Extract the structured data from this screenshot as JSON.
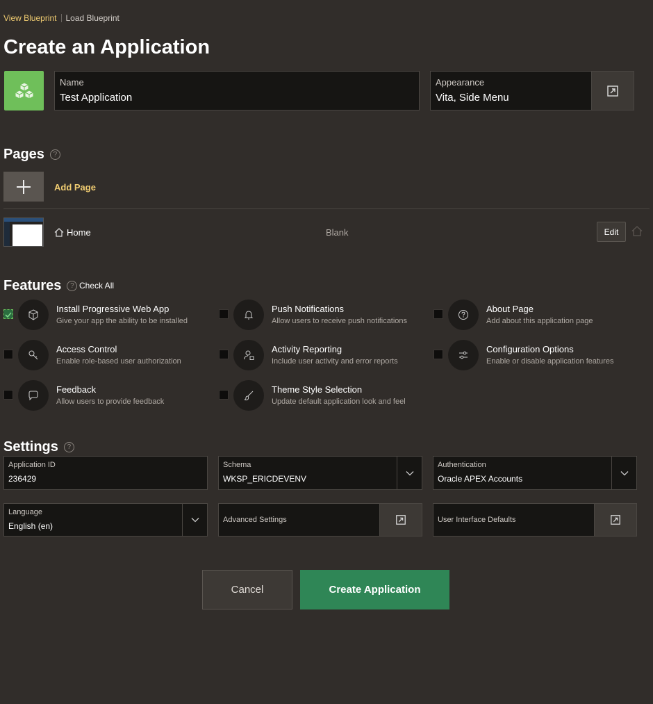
{
  "breadcrumb": {
    "active": "View Blueprint",
    "link": "Load Blueprint"
  },
  "title": "Create an Application",
  "app": {
    "name_label": "Name",
    "name_value": "Test Application",
    "appearance_label": "Appearance",
    "appearance_value": "Vita, Side Menu"
  },
  "pages": {
    "title": "Pages",
    "help": "?",
    "add_label": "Add Page",
    "items": [
      {
        "name": "Home",
        "type": "Blank",
        "edit_label": "Edit"
      }
    ]
  },
  "features": {
    "title": "Features",
    "help": "?",
    "check_all": "Check All",
    "items": [
      {
        "title": "Install Progressive Web App",
        "desc": "Give your app the ability to be installed",
        "checked": true,
        "icon": "cube-icon"
      },
      {
        "title": "Push Notifications",
        "desc": "Allow users to receive push notifications",
        "checked": false,
        "icon": "bell-icon"
      },
      {
        "title": "About Page",
        "desc": "Add about this application page",
        "checked": false,
        "icon": "question-icon"
      },
      {
        "title": "Access Control",
        "desc": "Enable role-based user authorization",
        "checked": false,
        "icon": "key-icon"
      },
      {
        "title": "Activity Reporting",
        "desc": "Include user activity and error reports",
        "checked": false,
        "icon": "user-report-icon"
      },
      {
        "title": "Configuration Options",
        "desc": "Enable or disable application features",
        "checked": false,
        "icon": "sliders-icon"
      },
      {
        "title": "Feedback",
        "desc": "Allow users to provide feedback",
        "checked": false,
        "icon": "chat-icon"
      },
      {
        "title": "Theme Style Selection",
        "desc": "Update default application look and feel",
        "checked": false,
        "icon": "brush-icon"
      }
    ]
  },
  "settings": {
    "title": "Settings",
    "help": "?",
    "application_id": {
      "label": "Application ID",
      "value": "236429"
    },
    "schema": {
      "label": "Schema",
      "value": "WKSP_ERICDEVENV"
    },
    "authentication": {
      "label": "Authentication",
      "value": "Oracle APEX Accounts"
    },
    "language": {
      "label": "Language",
      "value": "English (en)"
    },
    "advanced": {
      "label": "Advanced Settings"
    },
    "ui_defaults": {
      "label": "User Interface Defaults"
    }
  },
  "actions": {
    "cancel": "Cancel",
    "create": "Create Application"
  },
  "colors": {
    "accent": "#f0cc71",
    "primary": "#2f8656",
    "app_icon": "#6fbf5a",
    "background": "#312d2a"
  }
}
